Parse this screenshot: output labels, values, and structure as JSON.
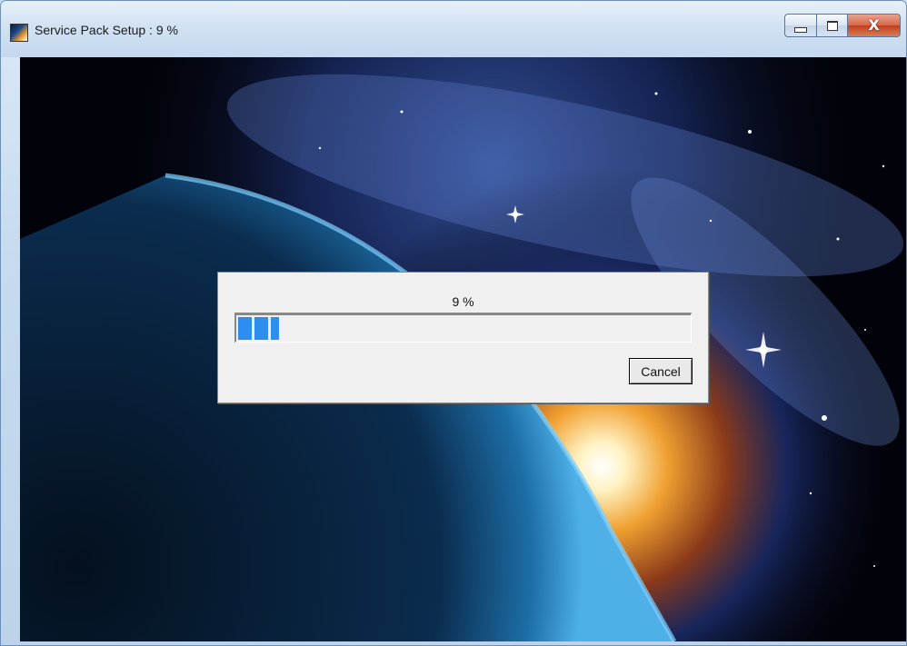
{
  "window": {
    "title": "Service Pack Setup : 9 %",
    "icon": "setup-app-icon"
  },
  "caption_buttons": {
    "minimize_icon": "minimize-icon",
    "maximize_icon": "maximize-icon",
    "close_glyph": "X"
  },
  "progress": {
    "label": "9 %",
    "value_percent": 9,
    "bar_color": "#2e8ef0"
  },
  "dialog": {
    "cancel_label": "Cancel"
  }
}
